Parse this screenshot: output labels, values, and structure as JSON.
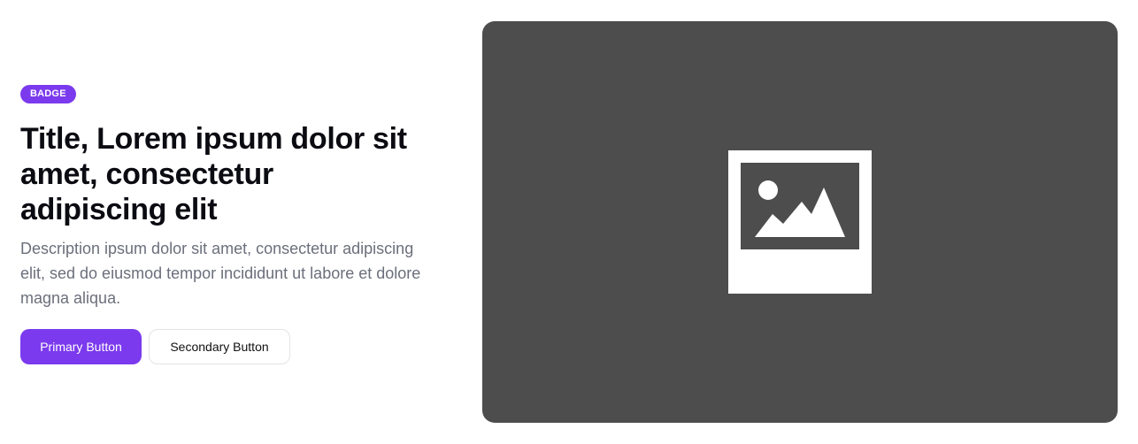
{
  "badge": {
    "label": "BADGE"
  },
  "hero": {
    "title": "Title, Lorem ipsum dolor sit amet, consectetur adipiscing elit",
    "description": "Description ipsum dolor sit amet, consectetur adipiscing elit, sed do eiusmod tempor incididunt ut labore et dolore magna aliqua."
  },
  "buttons": {
    "primary_label": "Primary Button",
    "secondary_label": "Secondary Button"
  },
  "media": {
    "icon": "image-placeholder-icon"
  },
  "colors": {
    "accent": "#7b3aed",
    "title": "#0b0b12",
    "description": "#6b6f7b",
    "media_background": "#4d4d4d"
  }
}
